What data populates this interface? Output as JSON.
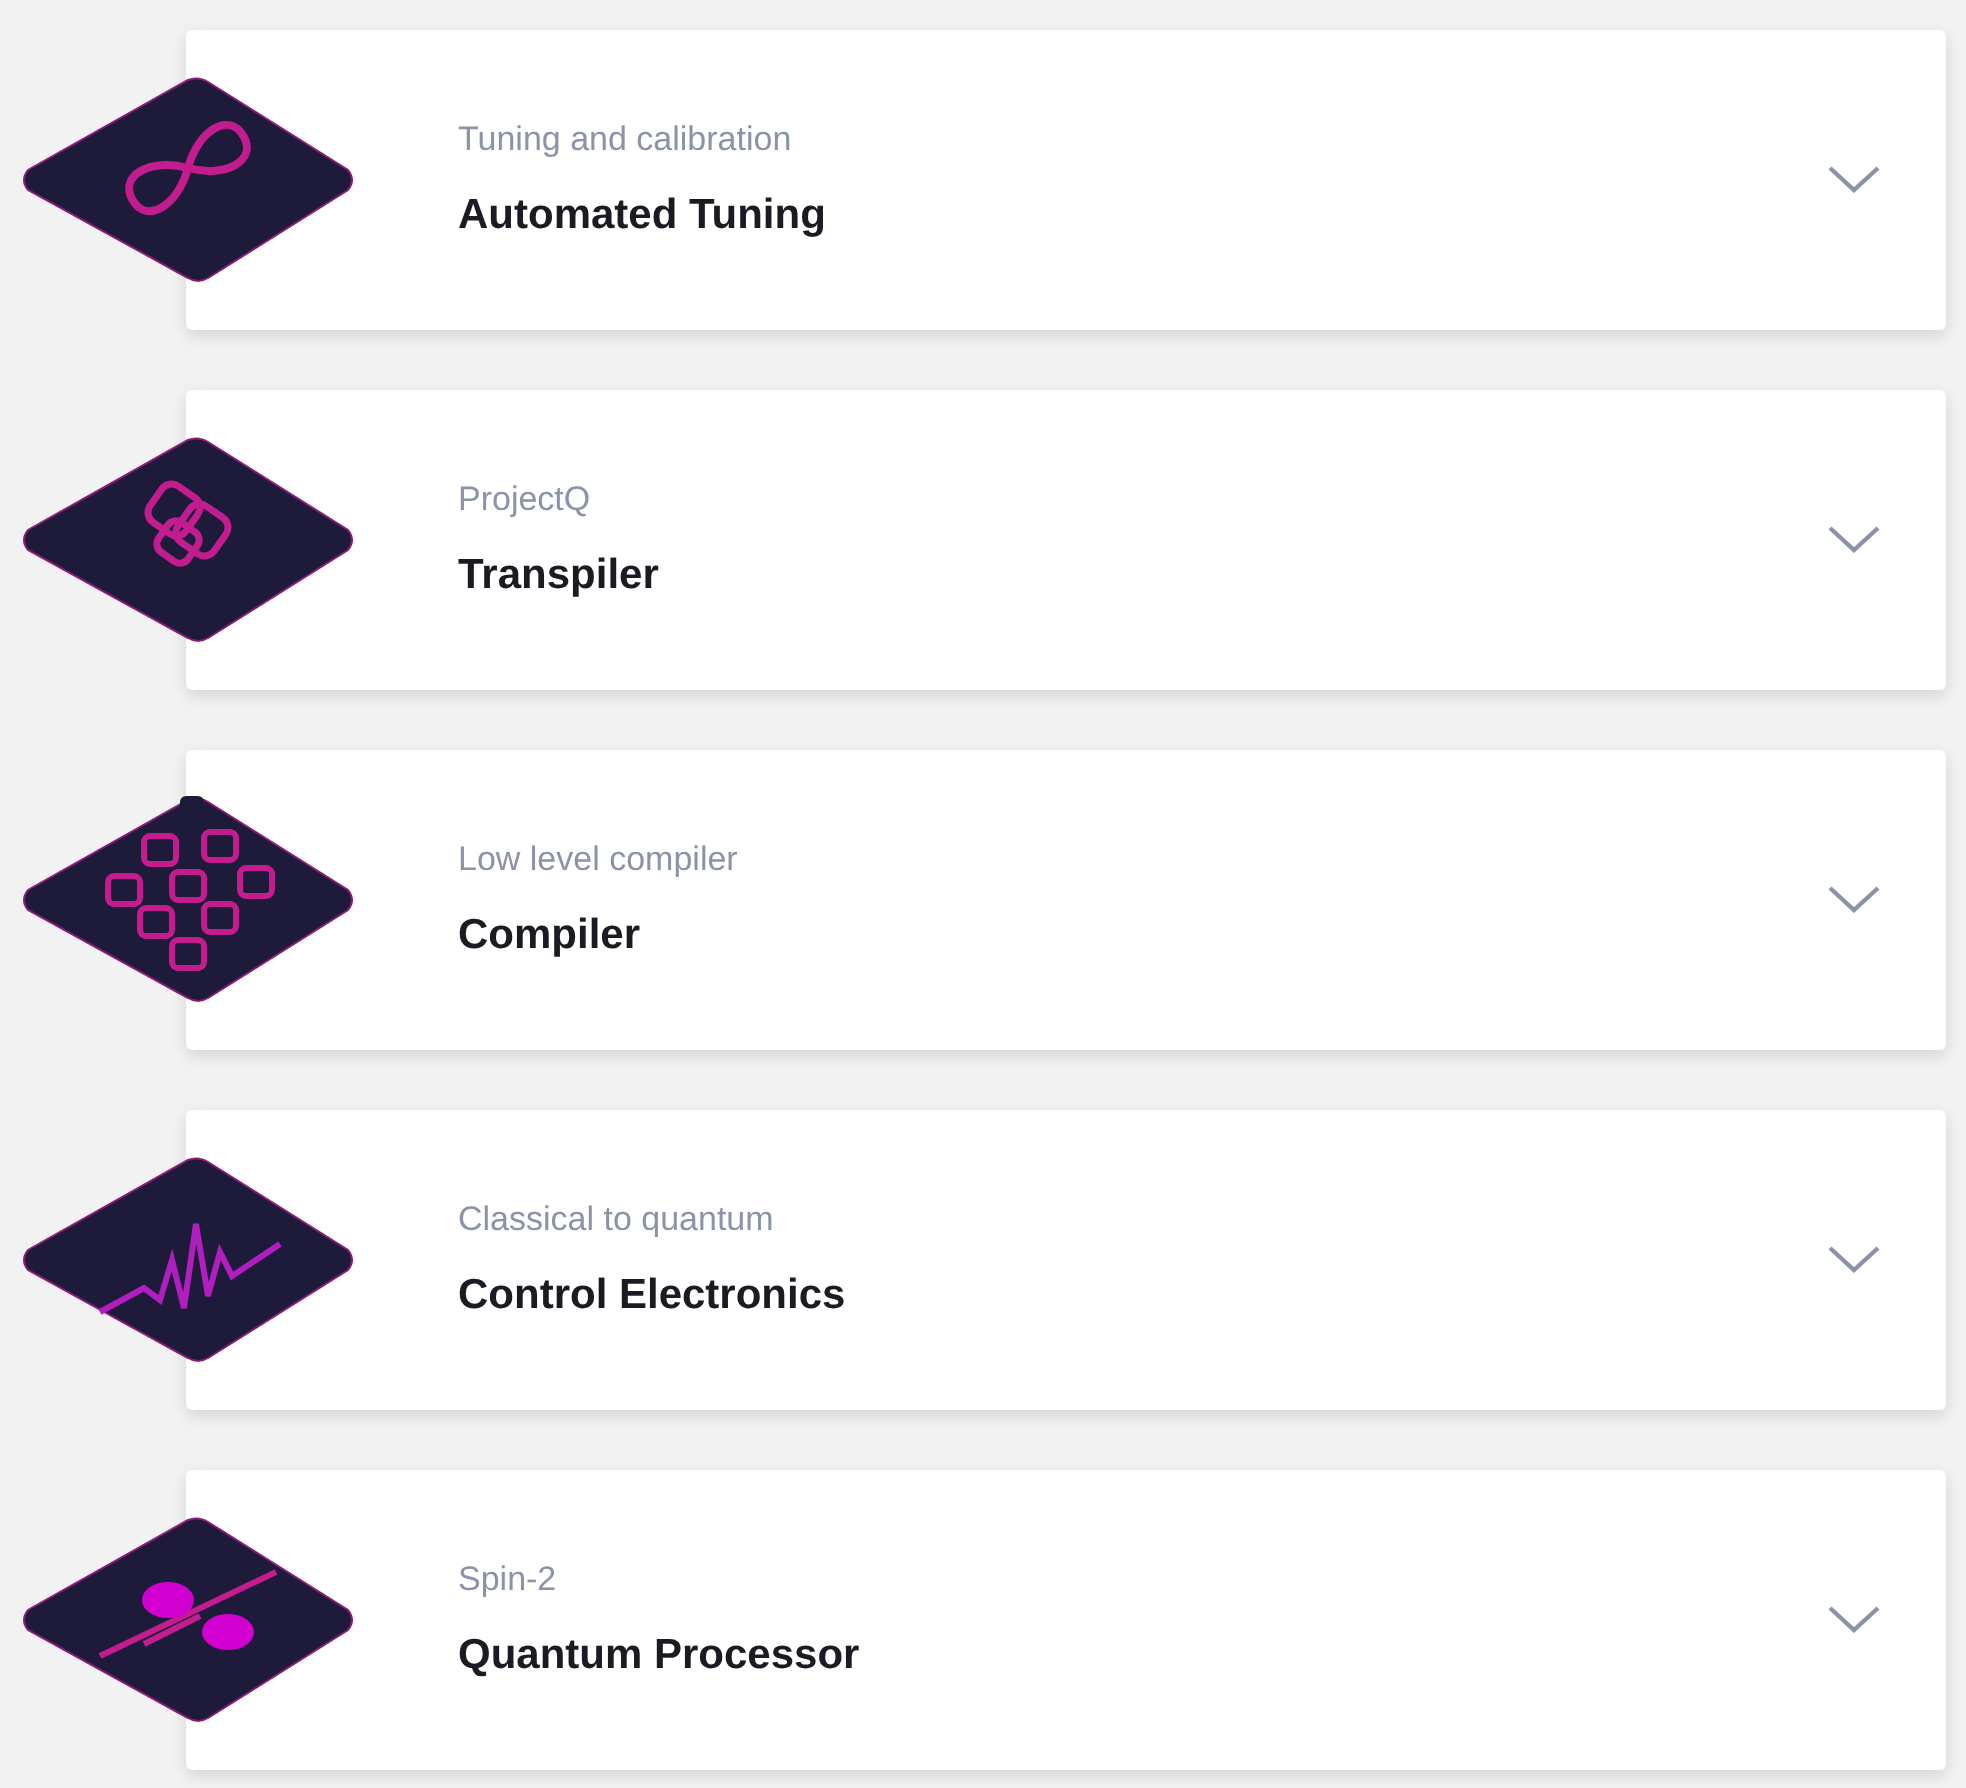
{
  "items": [
    {
      "kind": "infinity",
      "subtitle": "Tuning and calibration",
      "title": "Automated Tuning",
      "expanded": false
    },
    {
      "kind": "knot",
      "subtitle": "ProjectQ",
      "title": "Transpiler",
      "expanded": false
    },
    {
      "kind": "grid",
      "subtitle": "Low level compiler",
      "title": "Compiler",
      "expanded": false
    },
    {
      "kind": "wave",
      "subtitle": "Classical to quantum",
      "title": "Control Electronics",
      "expanded": false
    },
    {
      "kind": "qubits",
      "subtitle": "Spin-2",
      "title": "Quantum Processor",
      "expanded": false
    }
  ]
}
